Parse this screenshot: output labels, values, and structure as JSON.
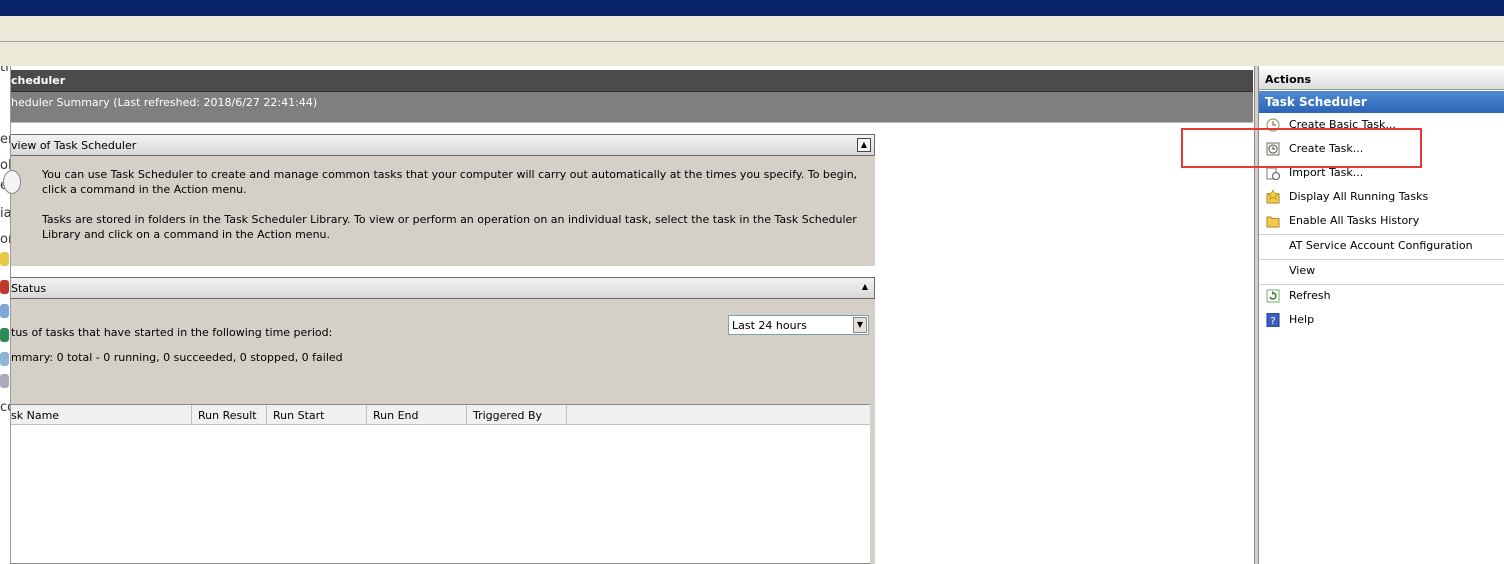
{
  "center": {
    "header_title": "cheduler",
    "summary_line": "heduler Summary (Last refreshed: 2018/6/27 22:41:44)",
    "overview": {
      "title": "view of Task Scheduler",
      "paragraph1": "You can use Task Scheduler to create and manage common tasks that your computer will carry out automatically at the times you specify. To begin, click a command in the Action menu.",
      "paragraph2": "Tasks are stored in folders in the Task Scheduler Library. To view or perform an operation on an individual task, select the task in the Task Scheduler Library and click on a command in the Action menu."
    },
    "status": {
      "title": "Status",
      "period_label": "tus of tasks that have started in the following time period:",
      "period_value": "Last 24 hours",
      "summary": "mmary: 0 total - 0 running, 0 succeeded, 0 stopped, 0 failed"
    },
    "grid_columns": [
      "sk Name",
      "Run Result",
      "Run Start",
      "Run End",
      "Triggered By"
    ]
  },
  "actions": {
    "header": "Actions",
    "group_title": "Task Scheduler",
    "items": [
      {
        "label": "Create Basic Task...",
        "icon": "create-basic-task-icon"
      },
      {
        "label": "Create Task...",
        "icon": "create-task-icon"
      },
      {
        "label": "Import Task...",
        "icon": "import-task-icon"
      },
      {
        "label": "Display All Running Tasks",
        "icon": "running-tasks-icon"
      },
      {
        "label": "Enable All Tasks History",
        "icon": "tasks-history-icon"
      },
      {
        "label": "AT Service Account Configuration",
        "icon": ""
      },
      {
        "label": "View",
        "icon": ""
      },
      {
        "label": "Refresh",
        "icon": "refresh-icon"
      },
      {
        "label": "Help",
        "icon": "help-icon"
      }
    ]
  },
  "left_strip": [
    "ti",
    "er",
    "ol",
    "ea",
    "ia",
    "or",
    "co"
  ],
  "highlight_color": "#e53935"
}
